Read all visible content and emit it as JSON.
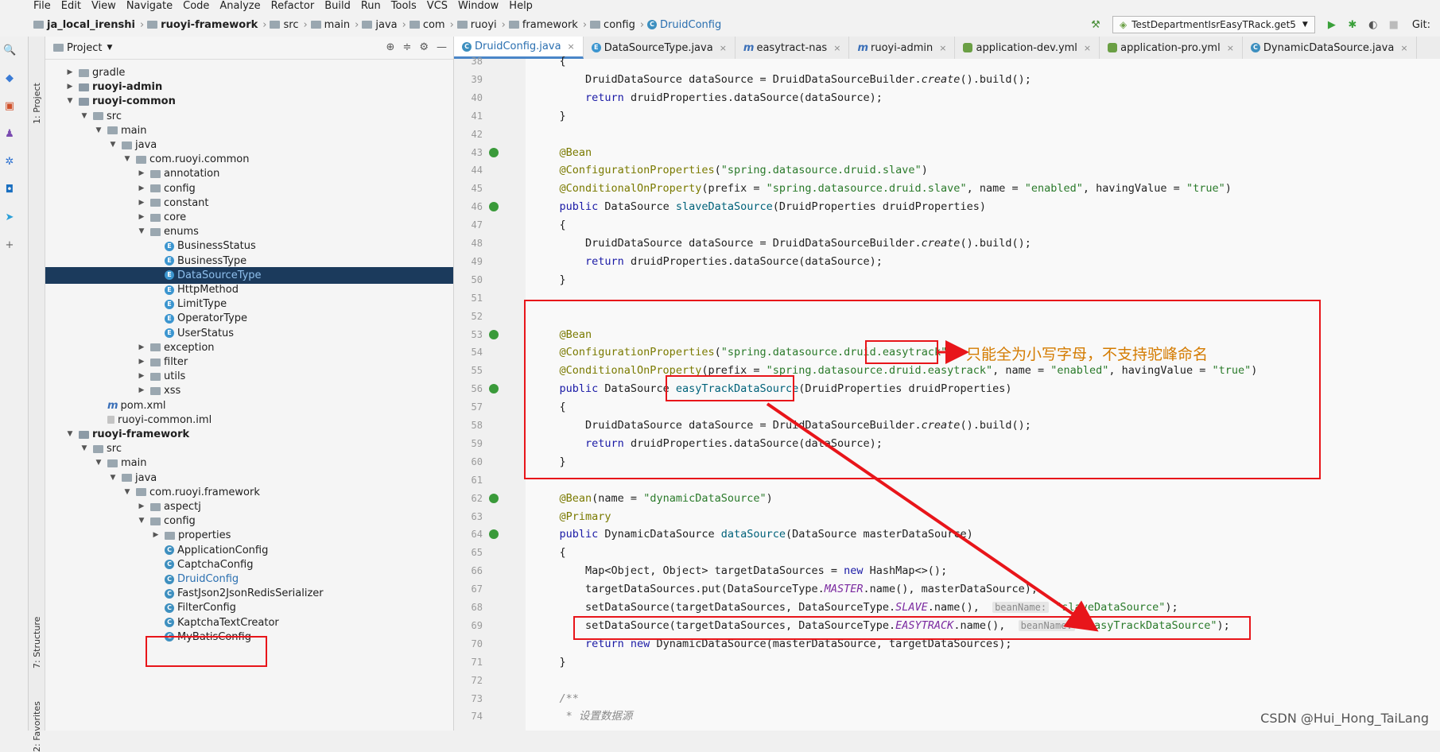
{
  "menu": [
    "File",
    "Edit",
    "View",
    "Navigate",
    "Code",
    "Analyze",
    "Refactor",
    "Build",
    "Run",
    "Tools",
    "VCS",
    "Window",
    "Help"
  ],
  "breadcrumbs": [
    "ja_local_irenshi",
    "ruoyi-framework",
    "src",
    "main",
    "java",
    "com",
    "ruoyi",
    "framework",
    "config",
    "DruidConfig"
  ],
  "run_config": "TestDepartmentIsrEasyTRack.get5",
  "git_label": "Git:",
  "project_panel_title": "Project",
  "side_tabs": {
    "project": "1: Project",
    "structure": "7: Structure",
    "favorites": "2: Favorites"
  },
  "tree": [
    {
      "label": "gradle",
      "indent": 1,
      "arrow": "▶",
      "type": "folder"
    },
    {
      "label": "ruoyi-admin",
      "indent": 1,
      "arrow": "▶",
      "type": "module",
      "bold": true
    },
    {
      "label": "ruoyi-common",
      "indent": 1,
      "arrow": "▼",
      "type": "module",
      "bold": true
    },
    {
      "label": "src",
      "indent": 2,
      "arrow": "▼",
      "type": "folder"
    },
    {
      "label": "main",
      "indent": 3,
      "arrow": "▼",
      "type": "folder"
    },
    {
      "label": "java",
      "indent": 4,
      "arrow": "▼",
      "type": "folder"
    },
    {
      "label": "com.ruoyi.common",
      "indent": 5,
      "arrow": "▼",
      "type": "package"
    },
    {
      "label": "annotation",
      "indent": 6,
      "arrow": "▶",
      "type": "package"
    },
    {
      "label": "config",
      "indent": 6,
      "arrow": "▶",
      "type": "package"
    },
    {
      "label": "constant",
      "indent": 6,
      "arrow": "▶",
      "type": "package"
    },
    {
      "label": "core",
      "indent": 6,
      "arrow": "▶",
      "type": "package"
    },
    {
      "label": "enums",
      "indent": 6,
      "arrow": "▼",
      "type": "package"
    },
    {
      "label": "BusinessStatus",
      "indent": 7,
      "arrow": "",
      "type": "enum"
    },
    {
      "label": "BusinessType",
      "indent": 7,
      "arrow": "",
      "type": "enum"
    },
    {
      "label": "DataSourceType",
      "indent": 7,
      "arrow": "",
      "type": "enum",
      "selected": true
    },
    {
      "label": "HttpMethod",
      "indent": 7,
      "arrow": "",
      "type": "enum"
    },
    {
      "label": "LimitType",
      "indent": 7,
      "arrow": "",
      "type": "enum"
    },
    {
      "label": "OperatorType",
      "indent": 7,
      "arrow": "",
      "type": "enum"
    },
    {
      "label": "UserStatus",
      "indent": 7,
      "arrow": "",
      "type": "enum"
    },
    {
      "label": "exception",
      "indent": 6,
      "arrow": "▶",
      "type": "package"
    },
    {
      "label": "filter",
      "indent": 6,
      "arrow": "▶",
      "type": "package"
    },
    {
      "label": "utils",
      "indent": 6,
      "arrow": "▶",
      "type": "package"
    },
    {
      "label": "xss",
      "indent": 6,
      "arrow": "▶",
      "type": "package"
    },
    {
      "label": "pom.xml",
      "indent": 3,
      "arrow": "",
      "type": "maven"
    },
    {
      "label": "ruoyi-common.iml",
      "indent": 3,
      "arrow": "",
      "type": "file"
    },
    {
      "label": "ruoyi-framework",
      "indent": 1,
      "arrow": "▼",
      "type": "module",
      "bold": true
    },
    {
      "label": "src",
      "indent": 2,
      "arrow": "▼",
      "type": "folder"
    },
    {
      "label": "main",
      "indent": 3,
      "arrow": "▼",
      "type": "folder"
    },
    {
      "label": "java",
      "indent": 4,
      "arrow": "▼",
      "type": "folder"
    },
    {
      "label": "com.ruoyi.framework",
      "indent": 5,
      "arrow": "▼",
      "type": "package"
    },
    {
      "label": "aspectj",
      "indent": 6,
      "arrow": "▶",
      "type": "package"
    },
    {
      "label": "config",
      "indent": 6,
      "arrow": "▼",
      "type": "package"
    },
    {
      "label": "properties",
      "indent": 7,
      "arrow": "▶",
      "type": "package"
    },
    {
      "label": "ApplicationConfig",
      "indent": 7,
      "arrow": "",
      "type": "class"
    },
    {
      "label": "CaptchaConfig",
      "indent": 7,
      "arrow": "",
      "type": "class"
    },
    {
      "label": "DruidConfig",
      "indent": 7,
      "arrow": "",
      "type": "class",
      "active": true
    },
    {
      "label": "FastJson2JsonRedisSerializer",
      "indent": 7,
      "arrow": "",
      "type": "class"
    },
    {
      "label": "FilterConfig",
      "indent": 7,
      "arrow": "",
      "type": "class"
    },
    {
      "label": "KaptchaTextCreator",
      "indent": 7,
      "arrow": "",
      "type": "class"
    },
    {
      "label": "MyBatisConfig",
      "indent": 7,
      "arrow": "",
      "type": "class"
    }
  ],
  "editor_tabs": [
    {
      "label": "DruidConfig.java",
      "icon": "class",
      "active": true
    },
    {
      "label": "DataSourceType.java",
      "icon": "enum"
    },
    {
      "label": "easytract-nas",
      "icon": "maven"
    },
    {
      "label": "ruoyi-admin",
      "icon": "maven"
    },
    {
      "label": "application-dev.yml",
      "icon": "yml"
    },
    {
      "label": "application-pro.yml",
      "icon": "yml"
    },
    {
      "label": "DynamicDataSource.java",
      "icon": "class"
    }
  ],
  "code_lines": [
    {
      "n": "38",
      "html": "    {"
    },
    {
      "n": "39",
      "html": "        DruidDataSource dataSource = DruidDataSourceBuilder.<span class='it'>create</span>().build();"
    },
    {
      "n": "40",
      "html": "        <span class='kw'>return</span> druidProperties.dataSource(dataSource);"
    },
    {
      "n": "41",
      "html": "    }"
    },
    {
      "n": "42",
      "html": ""
    },
    {
      "n": "43",
      "html": "    <span class='ann'>@Bean</span>"
    },
    {
      "n": "44",
      "html": "    <span class='ann'>@ConfigurationProperties</span>(<span class='str'>\"spring.datasource.druid.slave\"</span>)"
    },
    {
      "n": "45",
      "html": "    <span class='ann'>@ConditionalOnProperty</span>(prefix = <span class='str'>\"spring.datasource.druid.slave\"</span>, name = <span class='str'>\"enabled\"</span>, havingValue = <span class='str'>\"true\"</span>)"
    },
    {
      "n": "46",
      "html": "    <span class='kw'>public</span> DataSource <span class='fn'>slaveDataSource</span>(DruidProperties druidProperties)"
    },
    {
      "n": "47",
      "html": "    {"
    },
    {
      "n": "48",
      "html": "        DruidDataSource dataSource = DruidDataSourceBuilder.<span class='it'>create</span>().build();"
    },
    {
      "n": "49",
      "html": "        <span class='kw'>return</span> druidProperties.dataSource(dataSource);"
    },
    {
      "n": "50",
      "html": "    }"
    },
    {
      "n": "51",
      "html": ""
    },
    {
      "n": "52",
      "html": ""
    },
    {
      "n": "53",
      "html": "    <span class='ann'>@Bean</span>"
    },
    {
      "n": "54",
      "html": "    <span class='ann'>@ConfigurationProperties</span>(<span class='str'>\"spring.datasource.druid.easytrack\"</span>)"
    },
    {
      "n": "55",
      "html": "    <span class='ann'>@ConditionalOnProperty</span>(prefix = <span class='str'>\"spring.datasource.druid.easytrack\"</span>, name = <span class='str'>\"enabled\"</span>, havingValue = <span class='str'>\"true\"</span>)"
    },
    {
      "n": "56",
      "html": "    <span class='kw'>public</span> DataSource <span class='fn'>easyTrackDataSource</span>(DruidProperties druidProperties)"
    },
    {
      "n": "57",
      "html": "    {"
    },
    {
      "n": "58",
      "html": "        DruidDataSource dataSource = DruidDataSourceBuilder.<span class='it'>create</span>().build();"
    },
    {
      "n": "59",
      "html": "        <span class='kw'>return</span> druidProperties.dataSource(dataSource);"
    },
    {
      "n": "60",
      "html": "    }"
    },
    {
      "n": "61",
      "html": ""
    },
    {
      "n": "62",
      "html": "    <span class='ann'>@Bean</span>(name = <span class='str'>\"dynamicDataSource\"</span>)"
    },
    {
      "n": "63",
      "html": "    <span class='ann'>@Primary</span>"
    },
    {
      "n": "64",
      "html": "    <span class='kw'>public</span> DynamicDataSource <span class='fn'>dataSource</span>(DataSource masterDataSource)"
    },
    {
      "n": "65",
      "html": "    {"
    },
    {
      "n": "66",
      "html": "        Map&lt;Object, Object&gt; targetDataSources = <span class='kw'>new</span> HashMap&lt;&gt;();"
    },
    {
      "n": "67",
      "html": "        targetDataSources.put(DataSourceType.<span class='pur'>MASTER</span>.name(), masterDataSource);"
    },
    {
      "n": "68",
      "html": "        setDataSource(targetDataSources, DataSourceType.<span class='pur'>SLAVE</span>.name(),  <span class='hint'>beanName:</span> <span class='str'>\"slaveDataSource\"</span>);"
    },
    {
      "n": "69",
      "html": "        setDataSource(targetDataSources, DataSourceType.<span class='pur'>EASYTRACK</span>.name(),  <span class='hint'>beanName:</span> <span class='str'>\"easyTrackDataSource\"</span>);"
    },
    {
      "n": "70",
      "html": "        <span class='kw'>return new</span> DynamicDataSource(masterDataSource, targetDataSources);"
    },
    {
      "n": "71",
      "html": "    }"
    },
    {
      "n": "72",
      "html": ""
    },
    {
      "n": "73",
      "html": "    <span class='cm'>/**</span>"
    },
    {
      "n": "74",
      "html": "    <span class='cm'> * 设置数据源</span>"
    }
  ],
  "annotation_note": "只能全为小写字母，不支持驼峰命名",
  "watermark": "CSDN @Hui_Hong_TaiLang",
  "colors": {
    "highlight_red": "#e8151a",
    "note_orange": "#d47b00",
    "selection_bg": "#1b3a5c"
  }
}
